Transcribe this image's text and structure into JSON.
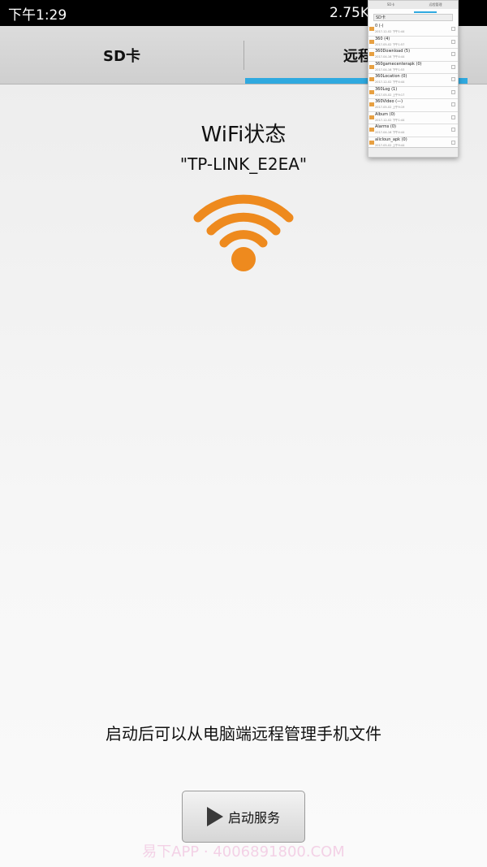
{
  "status_bar": {
    "time": "下午1:29",
    "speed": "2.75K"
  },
  "tabs": [
    {
      "label": "SD卡"
    },
    {
      "label": "远程管"
    }
  ],
  "wifi": {
    "title": "WiFi状态",
    "ssid": "\"TP-LINK_E2EA\"",
    "icon": "wifi-icon",
    "icon_color": "#ee8a1e"
  },
  "hint": "启动后可以从电脑端远程管理手机文件",
  "start_button": {
    "label": "启动服务",
    "icon": "play-icon"
  },
  "watermark": "易下APP · 4006891800.COM",
  "colors": {
    "accent": "#2fa9df",
    "wifi": "#ee8a1e"
  },
  "thumbnail": {
    "tabs": [
      "SD卡",
      "远程管理"
    ],
    "path": "SD卡",
    "items": [
      {
        "name": "0 (-)",
        "date": "2017-12-02 下午1:44"
      },
      {
        "name": "360 (4)",
        "date": "2017-05-02 下午1:57"
      },
      {
        "name": "360Download (5)",
        "date": "2017-04-16 下午4:44"
      },
      {
        "name": "360gamecenterapk (0)",
        "date": "2017-04-16 下午1:53"
      },
      {
        "name": "360Location (0)",
        "date": "2017-12-02 下午4:44"
      },
      {
        "name": "360Log (1)",
        "date": "2017-05-02 上午9:17"
      },
      {
        "name": "360Video (—)",
        "date": "2017-05-02 上午9:19"
      },
      {
        "name": "Album (0)",
        "date": "2017-12-02 下午1:44"
      },
      {
        "name": "Alarms (0)",
        "date": "2017-04-16 下午4:44"
      },
      {
        "name": "alicloun_apk (0)",
        "date": "2017-05-02 上午9:44"
      }
    ]
  }
}
